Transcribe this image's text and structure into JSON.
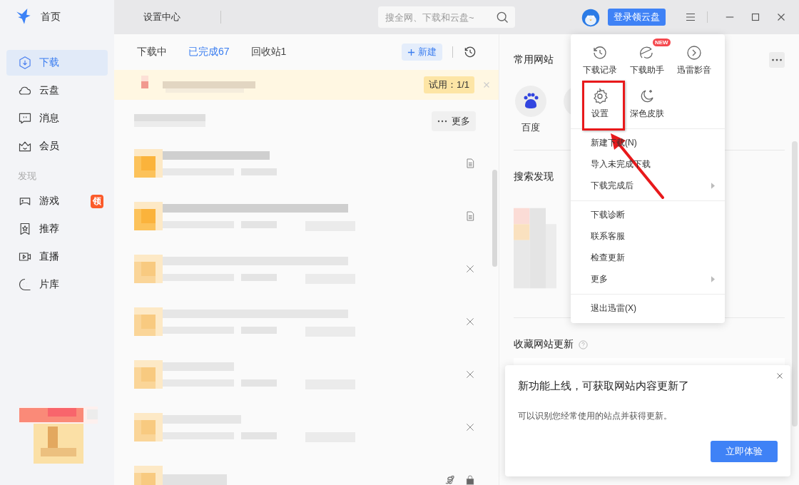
{
  "sidebar": {
    "title": "首页",
    "items": [
      {
        "label": "下载",
        "selected": true
      },
      {
        "label": "云盘",
        "selected": false
      },
      {
        "label": "消息",
        "selected": false
      },
      {
        "label": "会员",
        "selected": false
      }
    ],
    "section": "发现",
    "discover_items": [
      {
        "label": "游戏",
        "badge": "领",
        "selected": false
      },
      {
        "label": "推荐",
        "selected": false
      },
      {
        "label": "直播",
        "selected": false
      },
      {
        "label": "片库",
        "selected": false
      }
    ]
  },
  "topbar": {
    "title": "设置中心",
    "search": {
      "placeholder": "搜全网、下载和云盘~"
    },
    "login_button": "登录领云盘"
  },
  "download_panel": {
    "tabs": [
      {
        "label": "下载中",
        "selected": false
      },
      {
        "label": "已完成67",
        "selected": true
      },
      {
        "label": "回收站1",
        "selected": false
      }
    ],
    "new_button": "新建",
    "banner": {
      "badge": "试用：1/1"
    },
    "more_button": "更多",
    "rows": [
      {
        "kind": "file"
      },
      {
        "kind": "file"
      },
      {
        "kind": "remove"
      },
      {
        "kind": "remove"
      },
      {
        "kind": "remove"
      },
      {
        "kind": "remove"
      },
      {
        "kind": "web"
      }
    ]
  },
  "websites": {
    "title": "常用网站",
    "sites": [
      {
        "kind": "baidu",
        "label": "百度"
      },
      {
        "kind": "globe"
      }
    ]
  },
  "search_discover": {
    "title": "搜索发现"
  },
  "favorites": {
    "title": "收藏网站更新"
  },
  "menu": {
    "tiles": [
      {
        "label": "下载记录"
      },
      {
        "label": "下载助手",
        "badge": "NEW"
      },
      {
        "label": "迅雷影音"
      },
      {
        "label": "设置"
      },
      {
        "label": "深色皮肤"
      }
    ],
    "groups": [
      [
        {
          "label": "新建下载(N)",
          "submenu": false
        },
        {
          "label": "导入未完成下载",
          "submenu": false
        },
        {
          "label": "下载完成后",
          "submenu": true
        }
      ],
      [
        {
          "label": "下载诊断",
          "submenu": false
        },
        {
          "label": "联系客服",
          "submenu": false
        },
        {
          "label": "检查更新",
          "submenu": false
        },
        {
          "label": "更多",
          "submenu": true
        }
      ],
      [
        {
          "label": "退出迅雷(X)",
          "submenu": false
        }
      ]
    ]
  },
  "popup": {
    "title": "新功能上线，可获取网站内容更新了",
    "body": "可以识别您经常使用的站点并获得更新。",
    "button": "立即体验"
  }
}
